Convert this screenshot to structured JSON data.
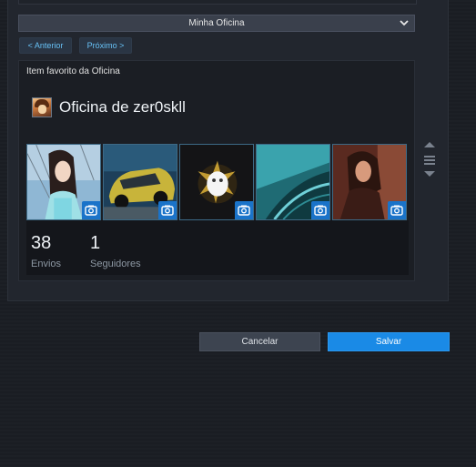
{
  "dropdown": {
    "value": "Minha Oficina"
  },
  "nav": {
    "prev_label": "< Anterior",
    "next_label": "Próximo >"
  },
  "showcase": {
    "title": "Item favorito da Oficina",
    "workshop_name": "Oficina de zer0skll",
    "items": [
      {
        "icon": "screenshot-icon"
      },
      {
        "icon": "screenshot-icon"
      },
      {
        "icon": "screenshot-icon"
      },
      {
        "icon": "screenshot-icon"
      },
      {
        "icon": "screenshot-icon"
      }
    ],
    "stats": [
      {
        "value": "38",
        "label": "Envios"
      },
      {
        "value": "1",
        "label": "Seguidores"
      }
    ]
  },
  "footer": {
    "cancel_label": "Cancelar",
    "save_label": "Salvar"
  },
  "colors": {
    "accent": "#1a8ae6",
    "link": "#67c1f5",
    "badge": "#1a73c9"
  }
}
